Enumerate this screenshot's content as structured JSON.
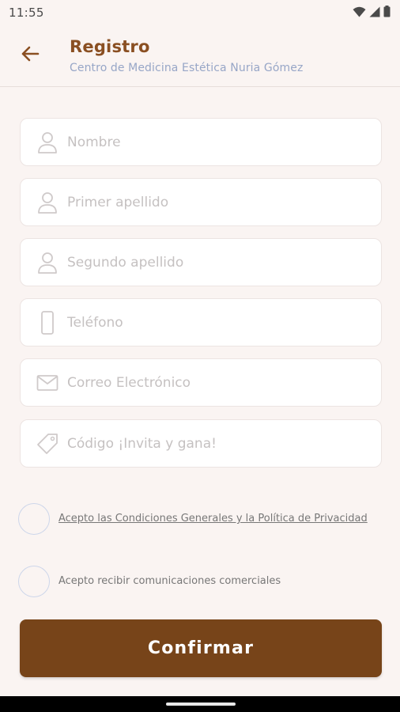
{
  "status_bar": {
    "time": "11:55",
    "icons": [
      "wifi-icon",
      "signal-icon",
      "battery-icon"
    ]
  },
  "header": {
    "title": "Registro",
    "subtitle": "Centro de Medicina Estética Nuria Gómez",
    "back_icon": "arrow-left-icon"
  },
  "form": {
    "fields": [
      {
        "placeholder": "Nombre",
        "value": "",
        "icon": "person-icon"
      },
      {
        "placeholder": "Primer apellido",
        "value": "",
        "icon": "person-icon"
      },
      {
        "placeholder": "Segundo apellido",
        "value": "",
        "icon": "person-icon"
      },
      {
        "placeholder": "Teléfono",
        "value": "",
        "icon": "phone-icon"
      },
      {
        "placeholder": "Correo Electrónico",
        "value": "",
        "icon": "mail-icon"
      },
      {
        "placeholder": "Código ¡Invita y gana!",
        "value": "",
        "icon": "ticket-icon"
      }
    ],
    "terms_label": "Acepto las Condiciones Generales y la Política de Privacidad",
    "terms_checked": false,
    "marketing_label": "Acepto recibir comunicaciones comerciales",
    "marketing_checked": false,
    "confirm_label": "Confirmar"
  },
  "colors": {
    "background": "#faf4f2",
    "accent": "#8a4f22",
    "button": "#774419",
    "subtitle": "#97a6c7"
  }
}
